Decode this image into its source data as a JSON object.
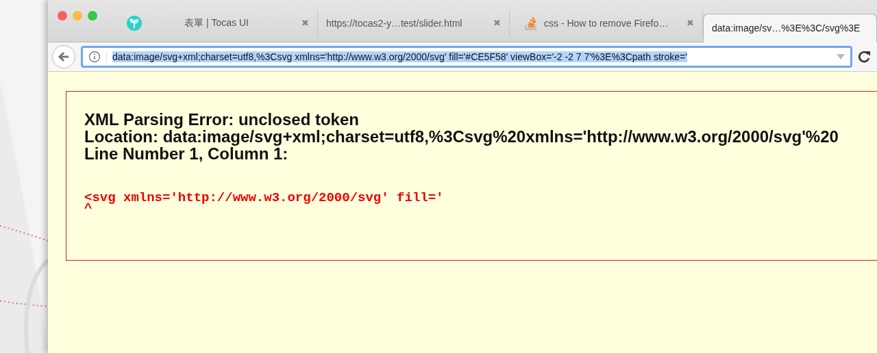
{
  "tabs": [
    {
      "kind": "leaf",
      "title": "表單 | Tocas UI",
      "close": "✖",
      "selected": false
    },
    {
      "kind": "none",
      "title": "https://tocas2-y…test/slider.html",
      "close": "✖",
      "selected": false
    },
    {
      "kind": "stack",
      "title": "css - How to remove Firefo…",
      "close": "✖",
      "selected": false
    },
    {
      "kind": "none",
      "title": "data:image/sv…%3E%3C/svg%3E",
      "selected": true
    }
  ],
  "address_bar": {
    "value": "data:image/svg+xml;charset=utf8,%3Csvg xmlns='http://www.w3.org/2000/svg' fill='#CE5F58' viewBox='-2 -2 7 7'%3E%3Cpath stroke='"
  },
  "error": {
    "lines": [
      "XML Parsing Error: unclosed token",
      "Location: data:image/svg+xml;charset=utf8,%3Csvg%20xmlns='http://www.w3.org/2000/svg'%20",
      "Line Number 1, Column 1:"
    ],
    "source": "<svg xmlns='http://www.w3.org/2000/svg' fill='",
    "caret": "^"
  }
}
